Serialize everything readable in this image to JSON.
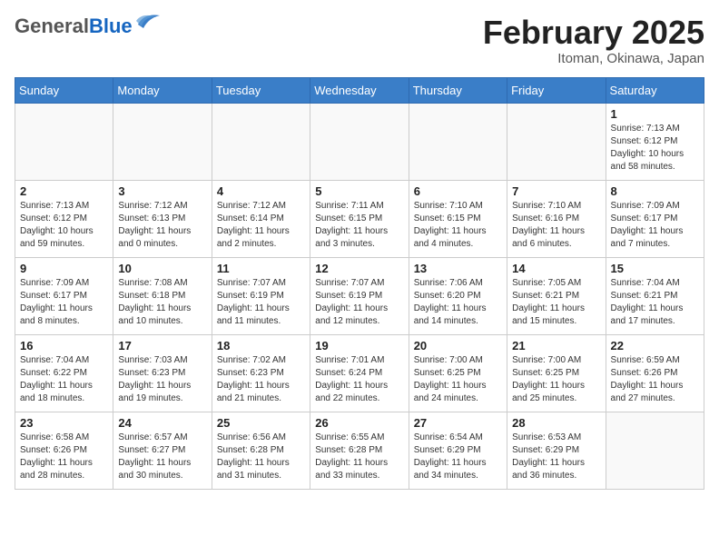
{
  "header": {
    "logo_general": "General",
    "logo_blue": "Blue",
    "month_title": "February 2025",
    "location": "Itoman, Okinawa, Japan"
  },
  "weekdays": [
    "Sunday",
    "Monday",
    "Tuesday",
    "Wednesday",
    "Thursday",
    "Friday",
    "Saturday"
  ],
  "weeks": [
    [
      {
        "day": "",
        "info": ""
      },
      {
        "day": "",
        "info": ""
      },
      {
        "day": "",
        "info": ""
      },
      {
        "day": "",
        "info": ""
      },
      {
        "day": "",
        "info": ""
      },
      {
        "day": "",
        "info": ""
      },
      {
        "day": "1",
        "info": "Sunrise: 7:13 AM\nSunset: 6:12 PM\nDaylight: 10 hours\nand 58 minutes."
      }
    ],
    [
      {
        "day": "2",
        "info": "Sunrise: 7:13 AM\nSunset: 6:12 PM\nDaylight: 10 hours\nand 59 minutes."
      },
      {
        "day": "3",
        "info": "Sunrise: 7:12 AM\nSunset: 6:13 PM\nDaylight: 11 hours\nand 0 minutes."
      },
      {
        "day": "4",
        "info": "Sunrise: 7:12 AM\nSunset: 6:14 PM\nDaylight: 11 hours\nand 2 minutes."
      },
      {
        "day": "5",
        "info": "Sunrise: 7:11 AM\nSunset: 6:15 PM\nDaylight: 11 hours\nand 3 minutes."
      },
      {
        "day": "6",
        "info": "Sunrise: 7:10 AM\nSunset: 6:15 PM\nDaylight: 11 hours\nand 4 minutes."
      },
      {
        "day": "7",
        "info": "Sunrise: 7:10 AM\nSunset: 6:16 PM\nDaylight: 11 hours\nand 6 minutes."
      },
      {
        "day": "8",
        "info": "Sunrise: 7:09 AM\nSunset: 6:17 PM\nDaylight: 11 hours\nand 7 minutes."
      }
    ],
    [
      {
        "day": "9",
        "info": "Sunrise: 7:09 AM\nSunset: 6:17 PM\nDaylight: 11 hours\nand 8 minutes."
      },
      {
        "day": "10",
        "info": "Sunrise: 7:08 AM\nSunset: 6:18 PM\nDaylight: 11 hours\nand 10 minutes."
      },
      {
        "day": "11",
        "info": "Sunrise: 7:07 AM\nSunset: 6:19 PM\nDaylight: 11 hours\nand 11 minutes."
      },
      {
        "day": "12",
        "info": "Sunrise: 7:07 AM\nSunset: 6:19 PM\nDaylight: 11 hours\nand 12 minutes."
      },
      {
        "day": "13",
        "info": "Sunrise: 7:06 AM\nSunset: 6:20 PM\nDaylight: 11 hours\nand 14 minutes."
      },
      {
        "day": "14",
        "info": "Sunrise: 7:05 AM\nSunset: 6:21 PM\nDaylight: 11 hours\nand 15 minutes."
      },
      {
        "day": "15",
        "info": "Sunrise: 7:04 AM\nSunset: 6:21 PM\nDaylight: 11 hours\nand 17 minutes."
      }
    ],
    [
      {
        "day": "16",
        "info": "Sunrise: 7:04 AM\nSunset: 6:22 PM\nDaylight: 11 hours\nand 18 minutes."
      },
      {
        "day": "17",
        "info": "Sunrise: 7:03 AM\nSunset: 6:23 PM\nDaylight: 11 hours\nand 19 minutes."
      },
      {
        "day": "18",
        "info": "Sunrise: 7:02 AM\nSunset: 6:23 PM\nDaylight: 11 hours\nand 21 minutes."
      },
      {
        "day": "19",
        "info": "Sunrise: 7:01 AM\nSunset: 6:24 PM\nDaylight: 11 hours\nand 22 minutes."
      },
      {
        "day": "20",
        "info": "Sunrise: 7:00 AM\nSunset: 6:25 PM\nDaylight: 11 hours\nand 24 minutes."
      },
      {
        "day": "21",
        "info": "Sunrise: 7:00 AM\nSunset: 6:25 PM\nDaylight: 11 hours\nand 25 minutes."
      },
      {
        "day": "22",
        "info": "Sunrise: 6:59 AM\nSunset: 6:26 PM\nDaylight: 11 hours\nand 27 minutes."
      }
    ],
    [
      {
        "day": "23",
        "info": "Sunrise: 6:58 AM\nSunset: 6:26 PM\nDaylight: 11 hours\nand 28 minutes."
      },
      {
        "day": "24",
        "info": "Sunrise: 6:57 AM\nSunset: 6:27 PM\nDaylight: 11 hours\nand 30 minutes."
      },
      {
        "day": "25",
        "info": "Sunrise: 6:56 AM\nSunset: 6:28 PM\nDaylight: 11 hours\nand 31 minutes."
      },
      {
        "day": "26",
        "info": "Sunrise: 6:55 AM\nSunset: 6:28 PM\nDaylight: 11 hours\nand 33 minutes."
      },
      {
        "day": "27",
        "info": "Sunrise: 6:54 AM\nSunset: 6:29 PM\nDaylight: 11 hours\nand 34 minutes."
      },
      {
        "day": "28",
        "info": "Sunrise: 6:53 AM\nSunset: 6:29 PM\nDaylight: 11 hours\nand 36 minutes."
      },
      {
        "day": "",
        "info": ""
      }
    ]
  ]
}
